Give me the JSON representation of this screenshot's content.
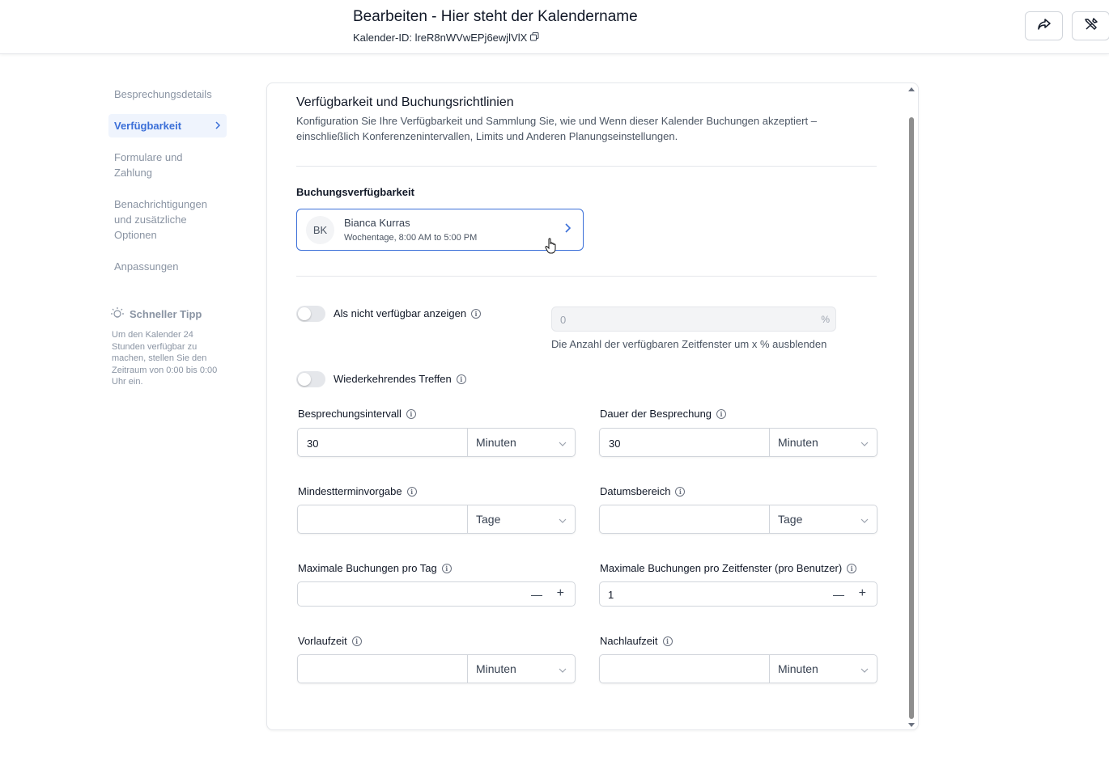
{
  "header": {
    "title": "Bearbeiten - Hier steht der Kalendername",
    "calendar_id": "Kalender-ID: lreR8nWVwEPj6ewjlVlX"
  },
  "sidebar": {
    "items": [
      {
        "label": "Besprechungsdetails"
      },
      {
        "label": "Verfügbarkeit"
      },
      {
        "label": "Formulare und Zahlung"
      },
      {
        "label": "Benachrichtigungen und zusätzliche Optionen"
      },
      {
        "label": "Anpassungen"
      }
    ],
    "tip_title": "Schneller Tipp",
    "tip_text": "Um den Kalender 24 Stunden verfügbar zu machen, stellen Sie den Zeitraum von 0:00 bis 0:00 Uhr ein."
  },
  "section": {
    "title": "Verfügbarkeit und Buchungsrichtlinien",
    "description": "Konfiguration Sie Ihre Verfügbarkeit und Sammlung Sie, wie und Wenn dieser Kalender Buchungen akzeptiert – einschließlich Konferenzenintervallen, Limits und Anderen Planungseinstellungen.",
    "booking_label": "Buchungsverfügbarkeit",
    "person": {
      "initials": "BK",
      "name": "Bianca Kurras",
      "schedule": "Wochentage, 8:00 AM to 5:00 PM"
    },
    "unavailable_label": "Als nicht verfügbar anzeigen",
    "unavailable_value": "0",
    "unavailable_suffix": "%",
    "unavailable_help": "Die Anzahl der verfügbaren Zeitfenster um x % ausblenden",
    "recurring_label": "Wiederkehrendes Treffen",
    "fields": {
      "interval": {
        "label": "Besprechungsintervall",
        "value": "30",
        "unit": "Minuten"
      },
      "duration": {
        "label": "Dauer der Besprechung",
        "value": "30",
        "unit": "Minuten"
      },
      "min_notice": {
        "label": "Mindestterminvorgabe",
        "value": "",
        "unit": "Tage"
      },
      "date_range": {
        "label": "Datumsbereich",
        "value": "",
        "unit": "Tage"
      },
      "max_per_day": {
        "label": "Maximale Buchungen pro Tag",
        "value": ""
      },
      "max_per_slot": {
        "label": "Maximale Buchungen pro Zeitfenster (pro Benutzer)",
        "value": "1"
      },
      "pre_buffer": {
        "label": "Vorlaufzeit",
        "value": "",
        "unit": "Minuten"
      },
      "post_buffer": {
        "label": "Nachlaufzeit",
        "value": "",
        "unit": "Minuten"
      }
    }
  },
  "colors": {
    "accent": "#3b6fd8",
    "muted": "#8a94a3"
  }
}
